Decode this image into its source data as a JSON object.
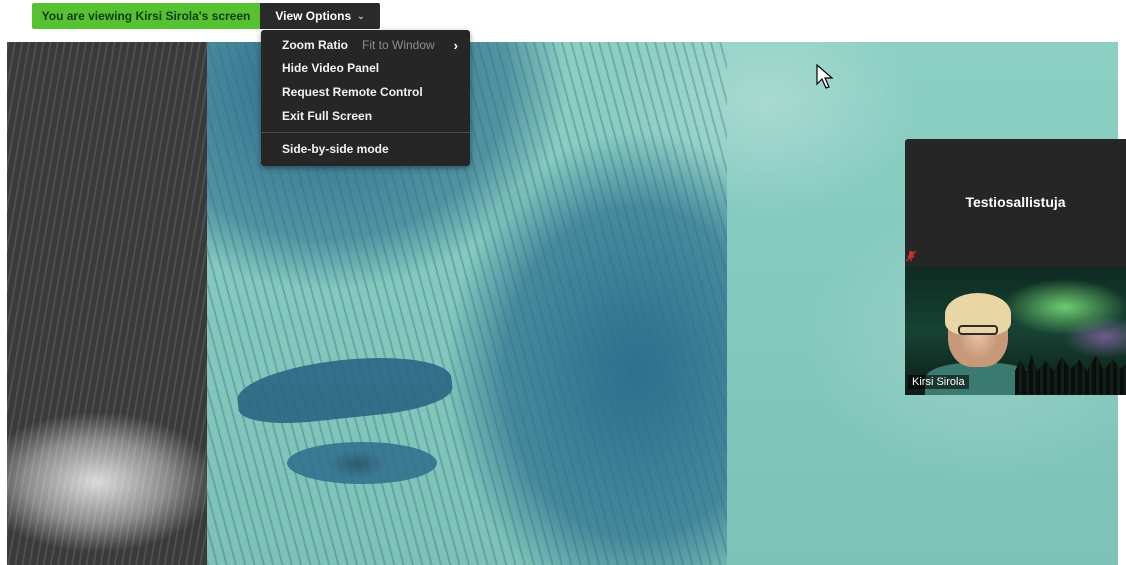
{
  "banner": {
    "viewing_text": "You are viewing Kirsi Sirola's screen",
    "view_options_label": "View Options",
    "view_options_chevron": "⌄"
  },
  "view_menu": {
    "items": [
      {
        "label": "Zoom Ratio",
        "sub": "Fit to Window",
        "has_submenu": true
      },
      {
        "label": "Hide Video Panel"
      },
      {
        "label": "Request Remote Control"
      },
      {
        "label": "Exit Full Screen"
      },
      {
        "label": "Side-by-side mode"
      }
    ],
    "submenu_arrow": "›"
  },
  "participant_panel": {
    "title": "Testiosallistuja",
    "muted_icon": "mic-muted-icon",
    "video_name": "Kirsi Sirola"
  },
  "colors": {
    "banner_green": "#56c232",
    "menu_bg": "#262626",
    "muted_red": "#d0312d"
  }
}
